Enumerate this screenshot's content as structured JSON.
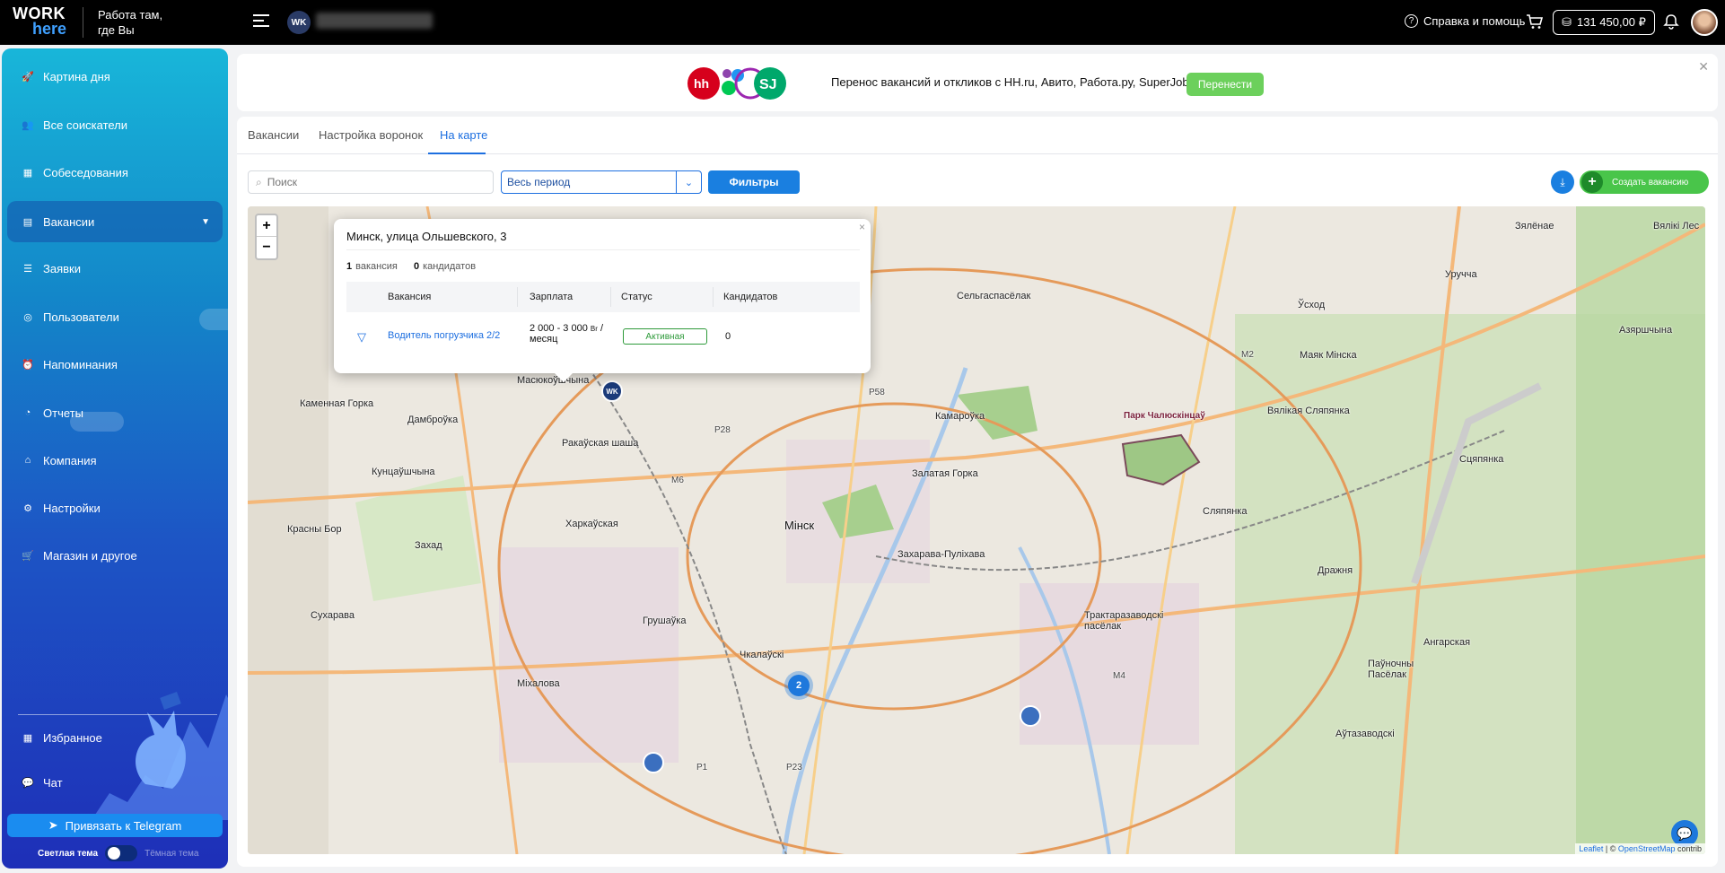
{
  "topbar": {
    "logo_line1": "WORK",
    "logo_line2": "here",
    "tagline": "Работа там, где Вы",
    "org_avatar": "WK",
    "help_label": "Справка и помощь",
    "balance": "131 450,00 ₽"
  },
  "sidebar": {
    "items": [
      {
        "label": "Картина дня",
        "icon": "rocket-icon"
      },
      {
        "label": "Все соискатели",
        "icon": "people-icon"
      },
      {
        "label": "Собеседования",
        "icon": "calendar-icon"
      },
      {
        "label": "Вакансии",
        "icon": "vacancies-icon"
      },
      {
        "label": "Заявки",
        "icon": "list-icon"
      },
      {
        "label": "Пользователи",
        "icon": "user-icon"
      },
      {
        "label": "Напоминания",
        "icon": "alarm-icon"
      },
      {
        "label": "Отчеты",
        "icon": "chart-icon"
      },
      {
        "label": "Компания",
        "icon": "home-icon"
      },
      {
        "label": "Настройки",
        "icon": "gear-icon"
      },
      {
        "label": "Магазин и другое",
        "icon": "cart-icon"
      }
    ],
    "bottom_items": [
      {
        "label": "Избранное",
        "icon": "grid-icon"
      },
      {
        "label": "Чат",
        "icon": "chat-icon"
      }
    ],
    "telegram_button": "Привязать к Telegram",
    "light_theme": "Светлая тема",
    "dark_theme": "Тёмная тема"
  },
  "banner": {
    "text": "Перенос вакансий и откликов с HH.ru, Авито, Работа.ру, SuperJob.ru",
    "button": "Перенести",
    "hh": "hh",
    "sj": "SJ"
  },
  "tabs": [
    "Вакансии",
    "Настройка воронок",
    "На карте"
  ],
  "toolbar": {
    "search_placeholder": "Поиск",
    "period": "Весь период",
    "filters": "Фильтры",
    "create": "Создать вакансию"
  },
  "popup": {
    "address": "Минск, улица Ольшевского, 3",
    "vacancies_count": "1",
    "vacancies_word": "вакансия",
    "candidates_count": "0",
    "candidates_word": "кандидатов",
    "columns": [
      "Вакансия",
      "Зарплата",
      "Статус",
      "Кандидатов"
    ],
    "row": {
      "vacancy": "Водитель погрузчика 2/2",
      "salary_line1": "2 000 - 3 000",
      "currency": "Br",
      "salary_sep": "/",
      "salary_line2": "месяц",
      "status": "Активная",
      "candidates": "0"
    }
  },
  "map": {
    "zoom_in": "+",
    "zoom_out": "−",
    "cluster_count": "2",
    "pin_label": "WK",
    "attribution_leaflet": "Leaflet",
    "attribution_sep": "| ©",
    "attribution_osm": "OpenStreetMap",
    "attribution_tail": "contrib",
    "labels": [
      {
        "text": "Мінск",
        "cls": "city"
      },
      {
        "text": "Сельгаспасёлак",
        "cls": "big"
      },
      {
        "text": "Масюкоўшчына",
        "cls": "big"
      },
      {
        "text": "Каменная Горка",
        "cls": "big"
      },
      {
        "text": "Дамброўка",
        "cls": "big"
      },
      {
        "text": "Ракаўская шаша",
        "cls": "big"
      },
      {
        "text": "Кунцаўшчына",
        "cls": "big"
      },
      {
        "text": "Красны Бор",
        "cls": "big"
      },
      {
        "text": "Захад",
        "cls": "big"
      },
      {
        "text": "Харкаўская",
        "cls": "big"
      },
      {
        "text": "Сухарава",
        "cls": "big"
      },
      {
        "text": "Грушаўка",
        "cls": "big"
      },
      {
        "text": "Чкалаўскі",
        "cls": "big"
      },
      {
        "text": "Міхалова",
        "cls": "big"
      },
      {
        "text": "Камароўка",
        "cls": "big"
      },
      {
        "text": "Залатая Горка",
        "cls": "big"
      },
      {
        "text": "Захарава-Пуліхава",
        "cls": "big"
      },
      {
        "text": "Сляпянка",
        "cls": "big"
      },
      {
        "text": "Вялікая Сляпянка",
        "cls": "big"
      },
      {
        "text": "Маяк Мінска",
        "cls": "big"
      },
      {
        "text": "Уручча",
        "cls": "big"
      },
      {
        "text": "Азяршчына",
        "cls": "big"
      },
      {
        "text": "Сцяпянка",
        "cls": "big"
      },
      {
        "text": "Дражня",
        "cls": "big"
      },
      {
        "text": "Трактаразаводскі пасёлак",
        "cls": "big"
      },
      {
        "text": "Ангарская",
        "cls": "big"
      },
      {
        "text": "Паўночны Пасёлак",
        "cls": "big"
      },
      {
        "text": "Аўтазаводскі",
        "cls": "big"
      },
      {
        "text": "Зялёнае",
        "cls": "big"
      },
      {
        "text": "Вялікі Лес",
        "cls": "big"
      },
      {
        "text": "Ўсход",
        "cls": "big"
      },
      {
        "text": "Парк Чалюскінцаў",
        "cls": "big"
      },
      {
        "text": "M2",
        "cls": ""
      },
      {
        "text": "M4",
        "cls": ""
      },
      {
        "text": "M6",
        "cls": ""
      },
      {
        "text": "P28",
        "cls": ""
      },
      {
        "text": "P23",
        "cls": ""
      },
      {
        "text": "P1",
        "cls": ""
      },
      {
        "text": "P58",
        "cls": ""
      }
    ]
  }
}
